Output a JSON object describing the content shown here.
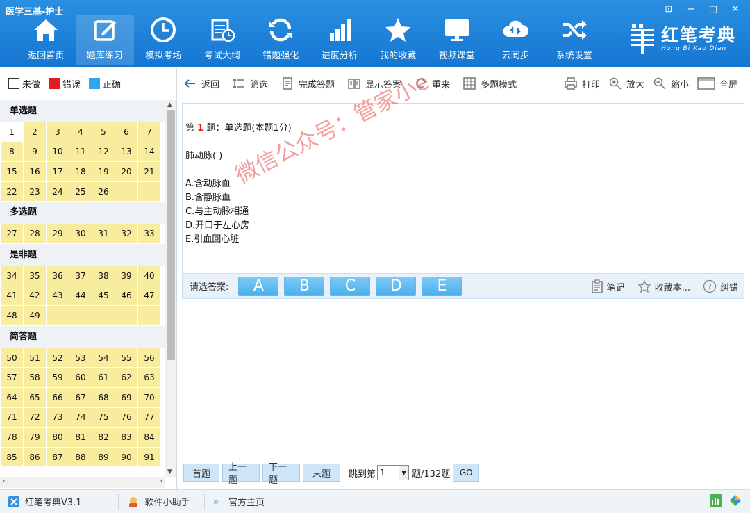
{
  "app": {
    "title": "医学三基-护士"
  },
  "window": {
    "pin": "⊡",
    "minimize": "−",
    "maximize": "□",
    "close": "✕"
  },
  "nav": {
    "items": [
      {
        "label": "返回首页",
        "icon": "home-icon"
      },
      {
        "label": "题库练习",
        "icon": "edit-icon"
      },
      {
        "label": "模拟考场",
        "icon": "clock-icon"
      },
      {
        "label": "考试大纲",
        "icon": "calendar-icon"
      },
      {
        "label": "错题强化",
        "icon": "refresh-icon"
      },
      {
        "label": "进度分析",
        "icon": "bar-chart-icon"
      },
      {
        "label": "我的收藏",
        "icon": "star-icon"
      },
      {
        "label": "视频课堂",
        "icon": "monitor-icon"
      },
      {
        "label": "云同步",
        "icon": "cloud-sync-icon"
      },
      {
        "label": "系统设置",
        "icon": "shuffle-icon"
      }
    ],
    "active_index": 1
  },
  "brand": {
    "name": "红笔考典",
    "pinyin": "Hong Bi Kao Dian"
  },
  "legend": {
    "unanswered": "未做",
    "wrong": "错误",
    "correct": "正确"
  },
  "sections": [
    {
      "title": "单选题",
      "numbers": [
        "1",
        "2",
        "3",
        "4",
        "5",
        "6",
        "7",
        "8",
        "9",
        "10",
        "11",
        "12",
        "13",
        "14",
        "15",
        "16",
        "17",
        "18",
        "19",
        "20",
        "21",
        "22",
        "23",
        "24",
        "25",
        "26"
      ]
    },
    {
      "title": "多选题",
      "numbers": [
        "27",
        "28",
        "29",
        "30",
        "31",
        "32",
        "33"
      ]
    },
    {
      "title": "是非题",
      "numbers": [
        "34",
        "35",
        "36",
        "37",
        "38",
        "39",
        "40",
        "41",
        "42",
        "43",
        "44",
        "45",
        "46",
        "47",
        "48",
        "49"
      ]
    },
    {
      "title": "简答题",
      "numbers": [
        "50",
        "51",
        "52",
        "53",
        "54",
        "55",
        "56",
        "57",
        "58",
        "59",
        "60",
        "61",
        "62",
        "63",
        "64",
        "65",
        "66",
        "67",
        "68",
        "69",
        "70",
        "71",
        "72",
        "73",
        "74",
        "75",
        "76",
        "77",
        "78",
        "79",
        "80",
        "81",
        "82",
        "83",
        "84",
        "85",
        "86",
        "87",
        "88",
        "89",
        "90",
        "91"
      ]
    }
  ],
  "current_question": "1",
  "toolbar": {
    "back": "返回",
    "filter": "筛选",
    "finish": "完成答题",
    "show_answer": "显示答案",
    "redo": "重来",
    "multi_mode": "多题模式",
    "print": "打印",
    "zoom_in": "放大",
    "zoom_out": "缩小",
    "fullscreen": "全屏"
  },
  "question": {
    "prefix": "第",
    "number": "1",
    "suffix": "题：单选题(本题1分)",
    "stem": "肺动脉( )",
    "options": [
      "A.含动脉血",
      "B.含静脉血",
      "C.与主动脉相通",
      "D.开口于左心房",
      "E.引血回心脏"
    ]
  },
  "watermark": "微信公众号：管家小e",
  "answer": {
    "label": "请选答案:",
    "choices": [
      "A",
      "B",
      "C",
      "D",
      "E"
    ],
    "note": "笔记",
    "favorite": "收藏本...",
    "correction": "纠错"
  },
  "pagination": {
    "first": "首题",
    "prev": "上一题",
    "next": "下一题",
    "last": "末题",
    "jump_label": "跳到第",
    "jump_value": "1",
    "total": "题/132题",
    "go": "GO"
  },
  "status": {
    "app_version": "红笔考典V3.1",
    "helper": "软件小助手",
    "homepage": "官方主页"
  }
}
